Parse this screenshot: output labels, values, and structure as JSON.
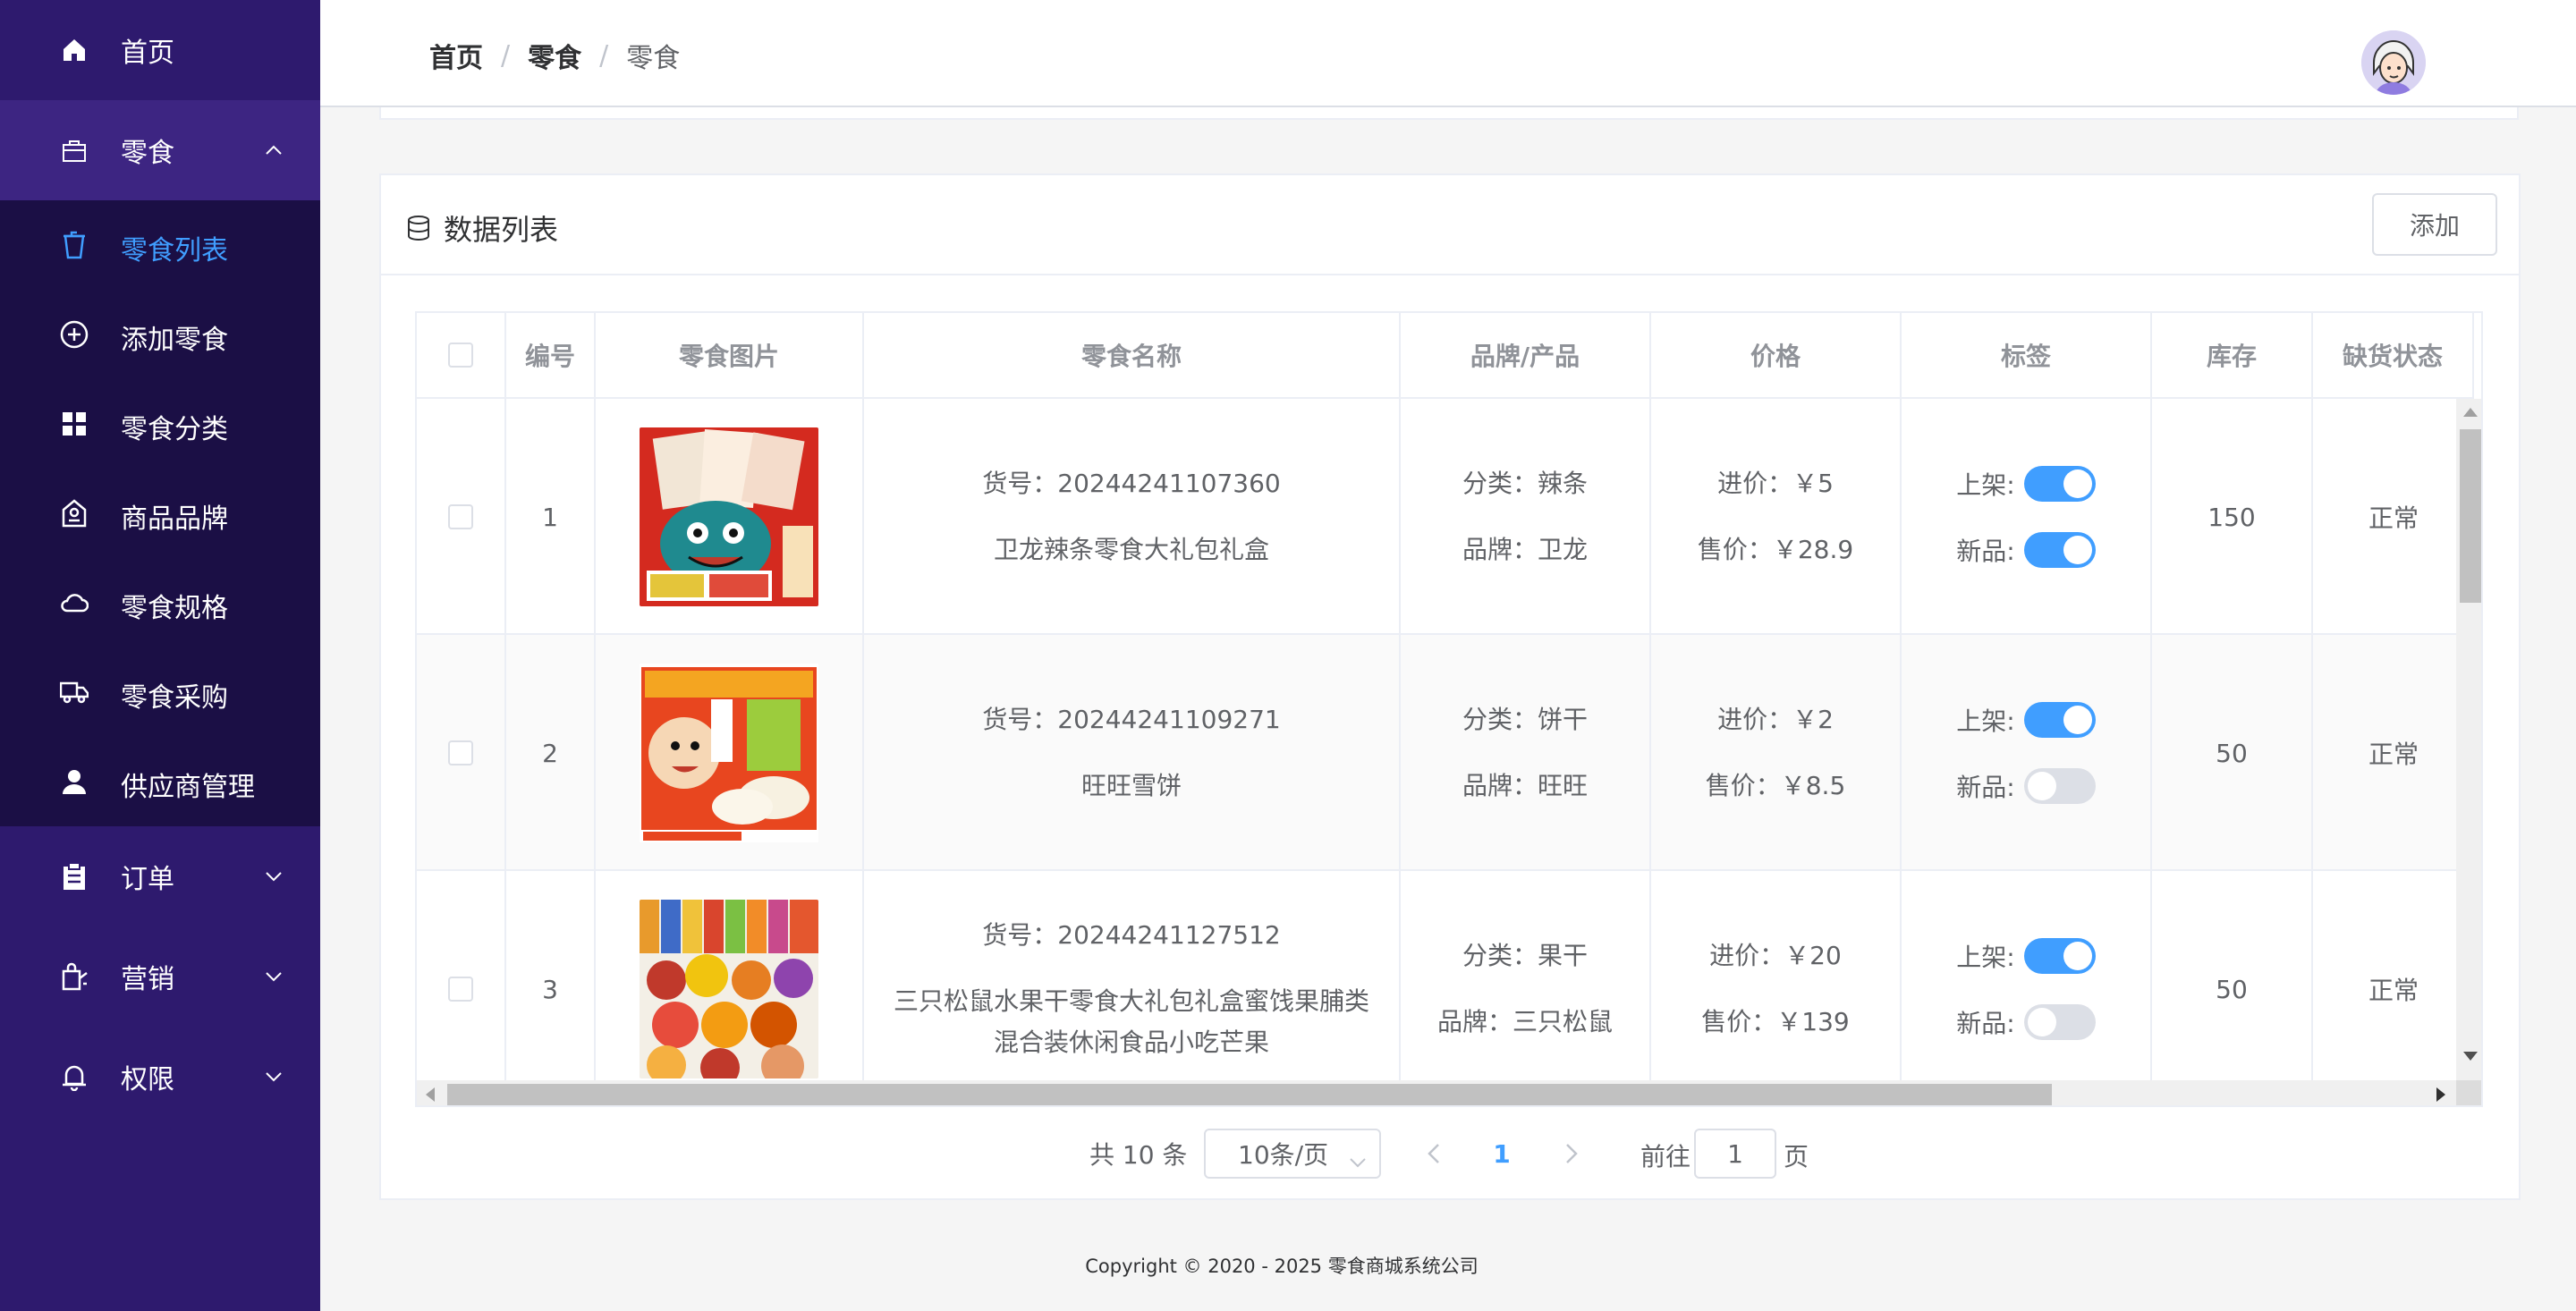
{
  "sidebar": {
    "items": [
      {
        "label": "首页",
        "icon": "home-icon"
      },
      {
        "label": "零食",
        "icon": "bag-icon",
        "expanded": true
      },
      {
        "label": "订单",
        "icon": "clipboard-icon"
      },
      {
        "label": "营销",
        "icon": "marketing-icon"
      },
      {
        "label": "权限",
        "icon": "bell-icon"
      }
    ],
    "submenu": [
      {
        "label": "零食列表",
        "icon": "cup-icon",
        "active": true
      },
      {
        "label": "添加零食",
        "icon": "plus-circle-icon"
      },
      {
        "label": "零食分类",
        "icon": "grid-icon"
      },
      {
        "label": "商品品牌",
        "icon": "brand-icon"
      },
      {
        "label": "零食规格",
        "icon": "cloud-icon"
      },
      {
        "label": "零食采购",
        "icon": "truck-icon"
      },
      {
        "label": "供应商管理",
        "icon": "user-icon"
      }
    ]
  },
  "breadcrumb": [
    "首页",
    "零食",
    "零食"
  ],
  "card": {
    "title": "数据列表",
    "add_label": "添加"
  },
  "table": {
    "headers": [
      "编号",
      "零食图片",
      "零食名称",
      "品牌/产品",
      "价格",
      "标签",
      "库存",
      "缺货状态"
    ],
    "rows": [
      {
        "id": "1",
        "sku": "货号：20244241107360",
        "name": [
          "卫龙辣条零食大礼包礼盒"
        ],
        "category": "分类：辣条",
        "brand": "品牌：卫龙",
        "cost": "进价：￥5",
        "price": "售价：￥28.9",
        "on_shelf_label": "上架:",
        "new_label": "新品:",
        "on_shelf": true,
        "is_new": true,
        "stock": "150",
        "status": "正常"
      },
      {
        "id": "2",
        "sku": "货号：20244241109271",
        "name": [
          "旺旺雪饼"
        ],
        "category": "分类：饼干",
        "brand": "品牌：旺旺",
        "cost": "进价：￥2",
        "price": "售价：￥8.5",
        "on_shelf_label": "上架:",
        "new_label": "新品:",
        "on_shelf": true,
        "is_new": false,
        "stock": "50",
        "status": "正常"
      },
      {
        "id": "3",
        "sku": "货号：20244241127512",
        "name": [
          "三只松鼠水果干零食大礼包礼盒蜜饯果脯类",
          "混合装休闲食品小吃芒果"
        ],
        "category": "分类：果干",
        "brand": "品牌：三只松鼠",
        "cost": "进价：￥20",
        "price": "售价：￥139",
        "on_shelf_label": "上架:",
        "new_label": "新品:",
        "on_shelf": true,
        "is_new": false,
        "stock": "50",
        "status": "正常"
      }
    ]
  },
  "pagination": {
    "total": "共 10 条",
    "page_size": "10条/页",
    "current": "1",
    "goto_prefix": "前往",
    "goto_value": "1",
    "goto_suffix": "页"
  },
  "footer": "Copyright © 2020 - 2025   零食商城系统公司",
  "colors": {
    "sidebar": "#2e1a6e",
    "submenu": "#1b0f45",
    "accent": "#409eff"
  }
}
